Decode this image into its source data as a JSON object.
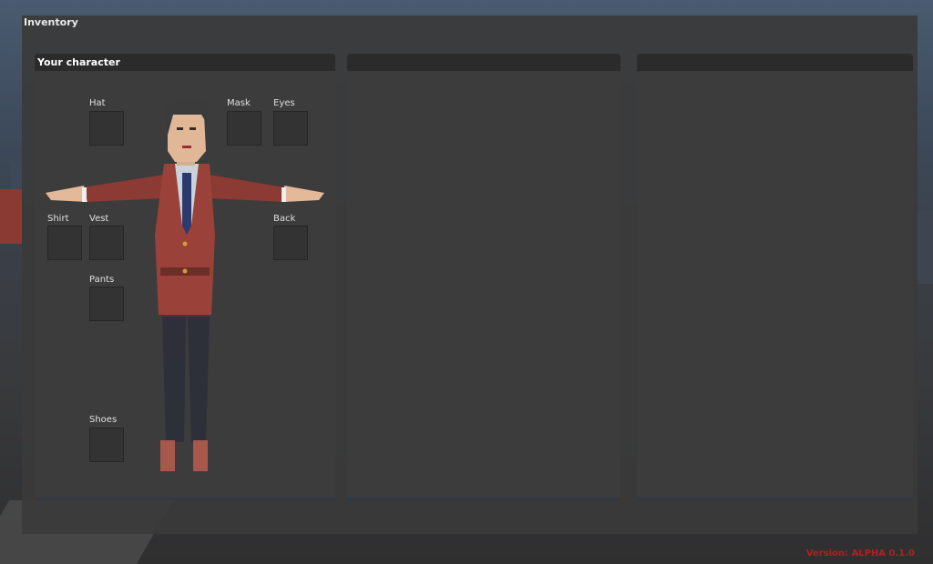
{
  "window": {
    "title": "Inventory"
  },
  "panels": {
    "character": {
      "title": "Your character",
      "slots": {
        "hat": "Hat",
        "mask": "Mask",
        "eyes": "Eyes",
        "shirt": "Shirt",
        "vest": "Vest",
        "back": "Back",
        "pants": "Pants",
        "shoes": "Shoes"
      }
    },
    "middle": {
      "title": ""
    },
    "right": {
      "title": ""
    }
  },
  "version": "Version: ALPHA 0.1.0",
  "colors": {
    "accent_version": "#b32020",
    "panel": "#3c3c3c",
    "header": "#2b2b2b"
  }
}
